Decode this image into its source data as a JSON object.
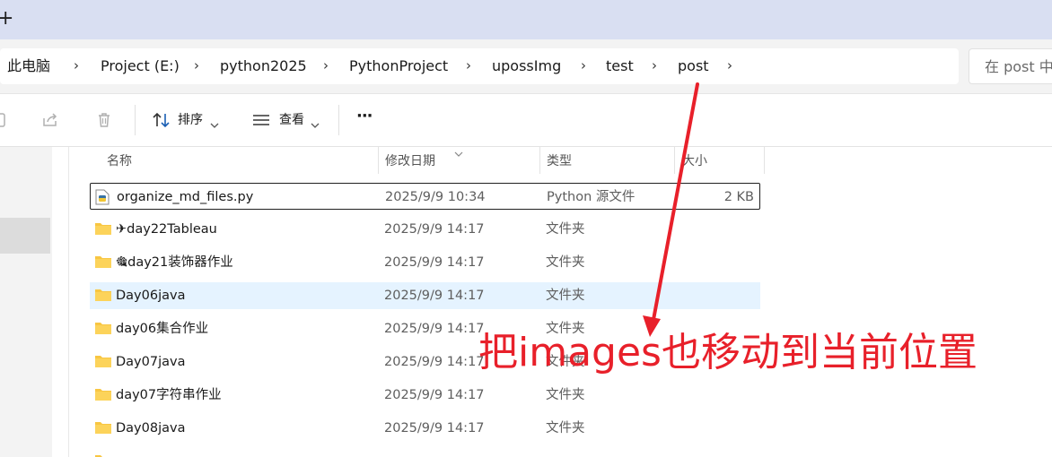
{
  "tabstrip": {
    "new_tab_glyph": "+"
  },
  "breadcrumb": {
    "items": [
      "此电脑",
      "Project (E:)",
      "python2025",
      "PythonProject",
      "upossImg",
      "test",
      "post"
    ],
    "separator": "›"
  },
  "search": {
    "placeholder": "在 post 中"
  },
  "toolbar": {
    "sort_label": "排序",
    "view_label": "查看",
    "more_label": "···"
  },
  "columns": {
    "name": "名称",
    "date": "修改日期",
    "type": "类型",
    "size": "大小"
  },
  "files": [
    {
      "name": "organize_md_files.py",
      "date": "2025/9/9 10:34",
      "type": "Python 源文件",
      "size": "2 KB",
      "icon": "python-file-icon"
    },
    {
      "name": "✈day22Tableau",
      "date": "2025/9/9 14:17",
      "type": "文件夹",
      "size": "",
      "icon": "folder-icon"
    },
    {
      "name": "🎕day21装饰器作业",
      "date": "2025/9/9 14:17",
      "type": "文件夹",
      "size": "",
      "icon": "folder-icon"
    },
    {
      "name": "Day06java",
      "date": "2025/9/9 14:17",
      "type": "文件夹",
      "size": "",
      "icon": "folder-icon"
    },
    {
      "name": "day06集合作业",
      "date": "2025/9/9 14:17",
      "type": "文件夹",
      "size": "",
      "icon": "folder-icon"
    },
    {
      "name": "Day07java",
      "date": "2025/9/9 14:17",
      "type": "文件夹",
      "size": "",
      "icon": "folder-icon"
    },
    {
      "name": "day07字符串作业",
      "date": "2025/9/9 14:17",
      "type": "文件夹",
      "size": "",
      "icon": "folder-icon"
    },
    {
      "name": "Day08java",
      "date": "2025/9/9 14:17",
      "type": "文件夹",
      "size": "",
      "icon": "folder-icon"
    }
  ],
  "annotation": {
    "text": "把images也移动到当前位置",
    "color": "#e8202a"
  },
  "colors": {
    "tab_strip": "#d9dff2",
    "hover_row": "#e5f3ff",
    "folder": "#f8c642",
    "annotation": "#e8202a"
  }
}
